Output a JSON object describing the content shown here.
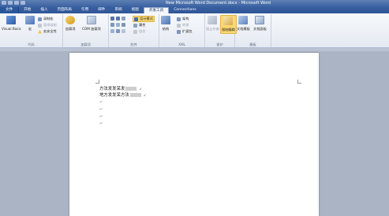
{
  "window": {
    "title": "New Microsoft Word Document.docx - Microsoft Word"
  },
  "tabs": [
    {
      "label": "文件"
    },
    {
      "label": "开始"
    },
    {
      "label": "插入"
    },
    {
      "label": "页面布局"
    },
    {
      "label": "引用"
    },
    {
      "label": "邮件"
    },
    {
      "label": "审阅"
    },
    {
      "label": "视图"
    },
    {
      "label": "开发工具"
    },
    {
      "label": "Connections"
    }
  ],
  "ribbon": {
    "code": {
      "label": "代码",
      "visual_basic": "Visual Basic",
      "macros": "宏",
      "record_macro": "录制宏",
      "pause_recording": "暂停录制",
      "macro_security": "宏安全性"
    },
    "addins": {
      "label": "加载项",
      "addins_btn": "加载项",
      "com_addins": "COM 加载项"
    },
    "controls": {
      "label": "控件",
      "design_mode": "设计模式",
      "properties": "属性",
      "group": "组合"
    },
    "xml": {
      "label": "XML",
      "structure": "结构",
      "schema": "架构",
      "transform": "转换",
      "expansion_pack": "扩展包"
    },
    "protect": {
      "label": "保护",
      "block_authors": "阻止作者",
      "restrict_editing": "限制编辑"
    },
    "templates": {
      "label": "模板",
      "document_template": "文档模板",
      "document_panel": "文档面板"
    }
  },
  "document": {
    "line1": "方法发发呆发",
    "line2": "地方发发呆方法",
    "para_mark": "↵",
    "field_mark": "↙"
  },
  "colors": {
    "titlebar": "#3f65a3",
    "tabbar": "#2f5597",
    "ribbon": "#eef2f8",
    "highlight": "#fcd86f",
    "workspace": "#aab4c4"
  }
}
